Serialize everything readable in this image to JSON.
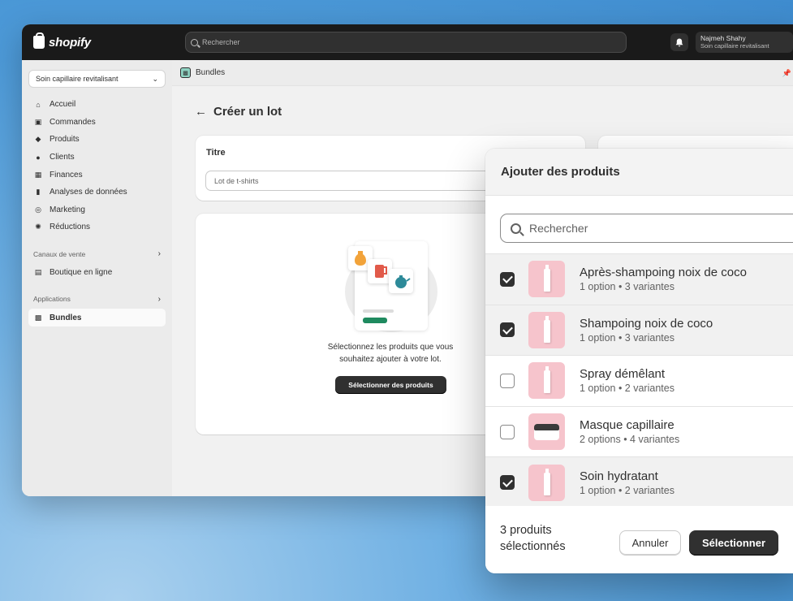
{
  "topbar": {
    "brand": "shopify",
    "search_placeholder": "Rechercher",
    "user_name": "Najmeh Shahy",
    "user_store": "Soin capillaire revitalisant"
  },
  "sidebar": {
    "store_selector": "Soin capillaire revitalisant",
    "items": [
      {
        "label": "Accueil",
        "icon": "home-icon"
      },
      {
        "label": "Commandes",
        "icon": "inbox-icon"
      },
      {
        "label": "Produits",
        "icon": "tag-icon"
      },
      {
        "label": "Clients",
        "icon": "person-icon"
      },
      {
        "label": "Finances",
        "icon": "bank-icon"
      },
      {
        "label": "Analyses de données",
        "icon": "chart-icon"
      },
      {
        "label": "Marketing",
        "icon": "target-icon"
      },
      {
        "label": "Réductions",
        "icon": "discount-icon"
      }
    ],
    "sales_channels_heading": "Canaux de vente",
    "sales_channels": [
      {
        "label": "Boutique en ligne",
        "icon": "store-icon"
      }
    ],
    "apps_heading": "Applications",
    "apps": [
      {
        "label": "Bundles",
        "icon": "bundles-app-icon"
      }
    ]
  },
  "main": {
    "app_name": "Bundles",
    "page_title": "Créer un lot",
    "title_card": {
      "label": "Titre",
      "placeholder": "Lot de t-shirts"
    },
    "empty_state": {
      "line1": "Sélectionnez les produits que vous",
      "line2": "souhaitez ajouter à votre lot.",
      "button": "Sélectionner des produits"
    }
  },
  "modal": {
    "title": "Ajouter des produits",
    "search_placeholder": "Rechercher",
    "products": [
      {
        "name": "Après-shampoing noix de coco",
        "meta": "1 option • 3 variantes",
        "selected": true,
        "thumb": "bottle"
      },
      {
        "name": "Shampoing noix de coco",
        "meta": "1 option • 3 variantes",
        "selected": true,
        "thumb": "bottle"
      },
      {
        "name": "Spray démêlant",
        "meta": "1 option • 2 variantes",
        "selected": false,
        "thumb": "bottle"
      },
      {
        "name": "Masque capillaire",
        "meta": "2 options • 4 variantes",
        "selected": false,
        "thumb": "jar"
      },
      {
        "name": "Soin hydratant",
        "meta": "1 option • 2 variantes",
        "selected": true,
        "thumb": "bottle"
      }
    ],
    "footer": {
      "count_line1": "3 produits",
      "count_line2": "sélectionnés",
      "cancel": "Annuler",
      "confirm": "Sélectionner"
    }
  },
  "colors": {
    "topbar": "#1a1a1a",
    "primary_button": "#303030",
    "thumb_bg": "#f6c4cc",
    "illus_green": "#1f8a5f"
  }
}
